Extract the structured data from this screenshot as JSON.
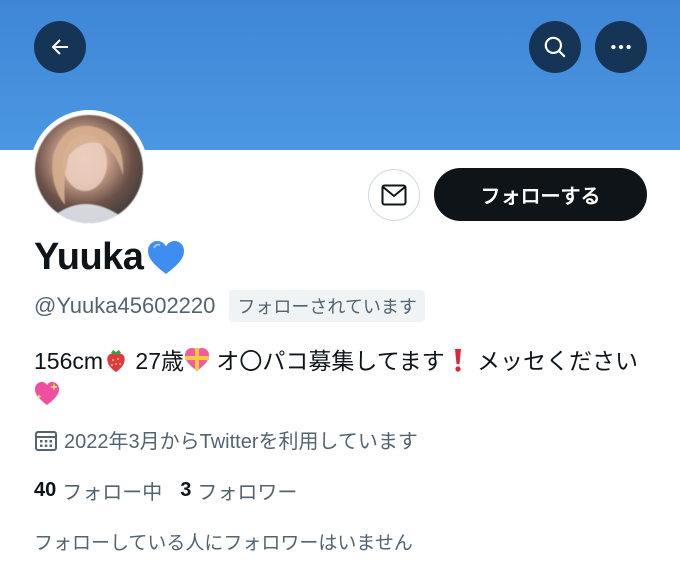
{
  "header": {
    "back_icon": "arrow-left-icon",
    "search_icon": "search-icon",
    "more_icon": "more-horizontal-icon",
    "banner_color": "#4a94e0",
    "button_color": "#163556"
  },
  "profile": {
    "display_name": "Yuuka",
    "name_emoji": "blue-heart-icon",
    "handle": "@Yuuka45602220",
    "follows_you_label": "フォローされています",
    "bio_parts": [
      "156cm",
      " 27歳",
      " オ〇パコ募集してます",
      " メッセください"
    ],
    "joined": "2022年3月からTwitterを利用しています",
    "joined_icon": "calendar-icon"
  },
  "actions": {
    "message_icon": "mail-icon",
    "follow_label": "フォローする"
  },
  "stats": {
    "following_count": "40",
    "following_label": "フォロー中",
    "followers_count": "3",
    "followers_label": "フォロワー"
  },
  "mutual_note": "フォローしている人にフォロワーはいません"
}
